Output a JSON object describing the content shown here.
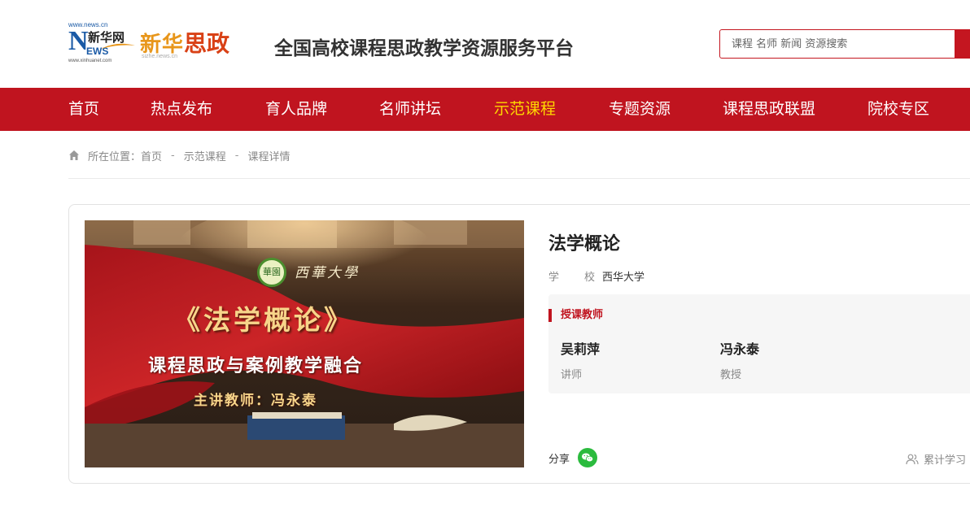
{
  "header": {
    "news_small": "www.news.cn",
    "news_logo_letter": "N",
    "news_logo_cn": "新华网",
    "news_logo_ews": "EWS",
    "news_logo_url": "www.xinhuanet.com",
    "brand_xinhua": "新华",
    "brand_sizheng": "思政",
    "brand_url": "sizhe.news.cn",
    "platform_title": "全国高校课程思政教学资源服务平台",
    "search_placeholder": "课程 名师 新闻 资源搜索"
  },
  "nav": {
    "items": [
      {
        "label": "首页"
      },
      {
        "label": "热点发布"
      },
      {
        "label": "育人品牌"
      },
      {
        "label": "名师讲坛"
      },
      {
        "label": "示范课程"
      },
      {
        "label": "专题资源"
      },
      {
        "label": "课程思政联盟"
      },
      {
        "label": "院校专区"
      }
    ],
    "active_label": "示范课程"
  },
  "breadcrumb": {
    "prefix": "所在位置：",
    "items": [
      "首页",
      "示范课程",
      "课程详情"
    ],
    "separator": "-"
  },
  "course": {
    "cover": {
      "logo_text": "華園",
      "school_calligraphy": "西華大學",
      "title": "《法学概论》",
      "subtitle": "课程思政与案例教学融合",
      "teacher_line": "主讲教师：冯永泰"
    },
    "title": "法学概论",
    "school_label_1": "学",
    "school_label_2": "校",
    "school": "西华大学",
    "teachers_heading": "授课教师",
    "teachers": [
      {
        "name": "吴莉萍",
        "rank": "讲师"
      },
      {
        "name": "冯永泰",
        "rank": "教授"
      }
    ],
    "share_label": "分享",
    "study_label": "累计学习"
  },
  "colors": {
    "brand_red": "#c0141f",
    "nav_active": "#ffd800",
    "wechat_green": "#2bbb3e"
  }
}
